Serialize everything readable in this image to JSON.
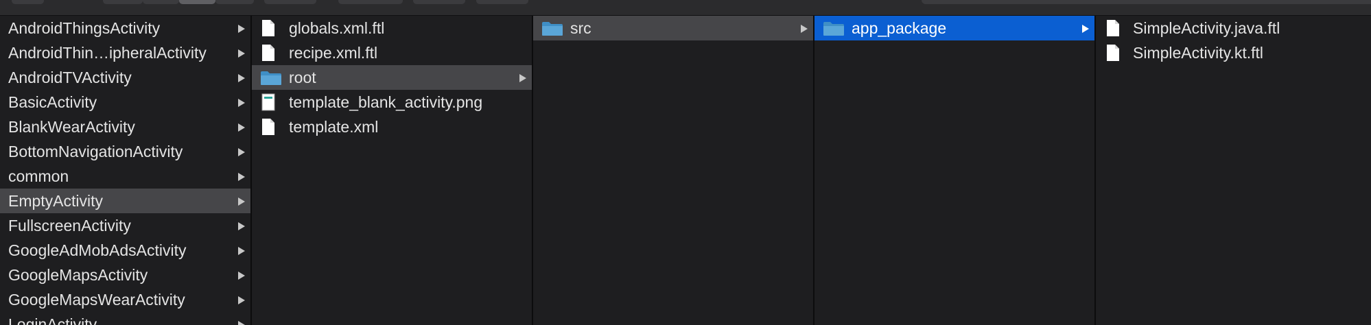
{
  "column1": {
    "items": [
      {
        "label": "AndroidThingsActivity"
      },
      {
        "label": "AndroidThin…ipheralActivity"
      },
      {
        "label": "AndroidTVActivity"
      },
      {
        "label": "BasicActivity"
      },
      {
        "label": "BlankWearActivity"
      },
      {
        "label": "BottomNavigationActivity"
      },
      {
        "label": "common"
      },
      {
        "label": "EmptyActivity",
        "selected": "inactive"
      },
      {
        "label": "FullscreenActivity"
      },
      {
        "label": "GoogleAdMobAdsActivity"
      },
      {
        "label": "GoogleMapsActivity"
      },
      {
        "label": "GoogleMapsWearActivity"
      },
      {
        "label": "LoginActivity"
      }
    ]
  },
  "column2": {
    "items": [
      {
        "label": "globals.xml.ftl",
        "icon": "document-icon"
      },
      {
        "label": "recipe.xml.ftl",
        "icon": "document-icon"
      },
      {
        "label": "root",
        "icon": "folder-icon",
        "selected": "inactive"
      },
      {
        "label": "template_blank_activity.png",
        "icon": "image-file-icon"
      },
      {
        "label": "template.xml",
        "icon": "document-icon"
      }
    ]
  },
  "column3": {
    "items": [
      {
        "label": "src",
        "icon": "folder-icon",
        "selected": "inactive"
      }
    ]
  },
  "column4": {
    "items": [
      {
        "label": "app_package",
        "icon": "folder-icon",
        "selected": "active"
      }
    ]
  },
  "column5": {
    "items": [
      {
        "label": "SimpleActivity.java.ftl",
        "icon": "document-icon"
      },
      {
        "label": "SimpleActivity.kt.ftl",
        "icon": "document-icon"
      }
    ]
  },
  "colors": {
    "background": "#1e1e20",
    "selection_active": "#0b5fd2",
    "selection_inactive": "#464649",
    "folder": "#5aa6d8"
  }
}
